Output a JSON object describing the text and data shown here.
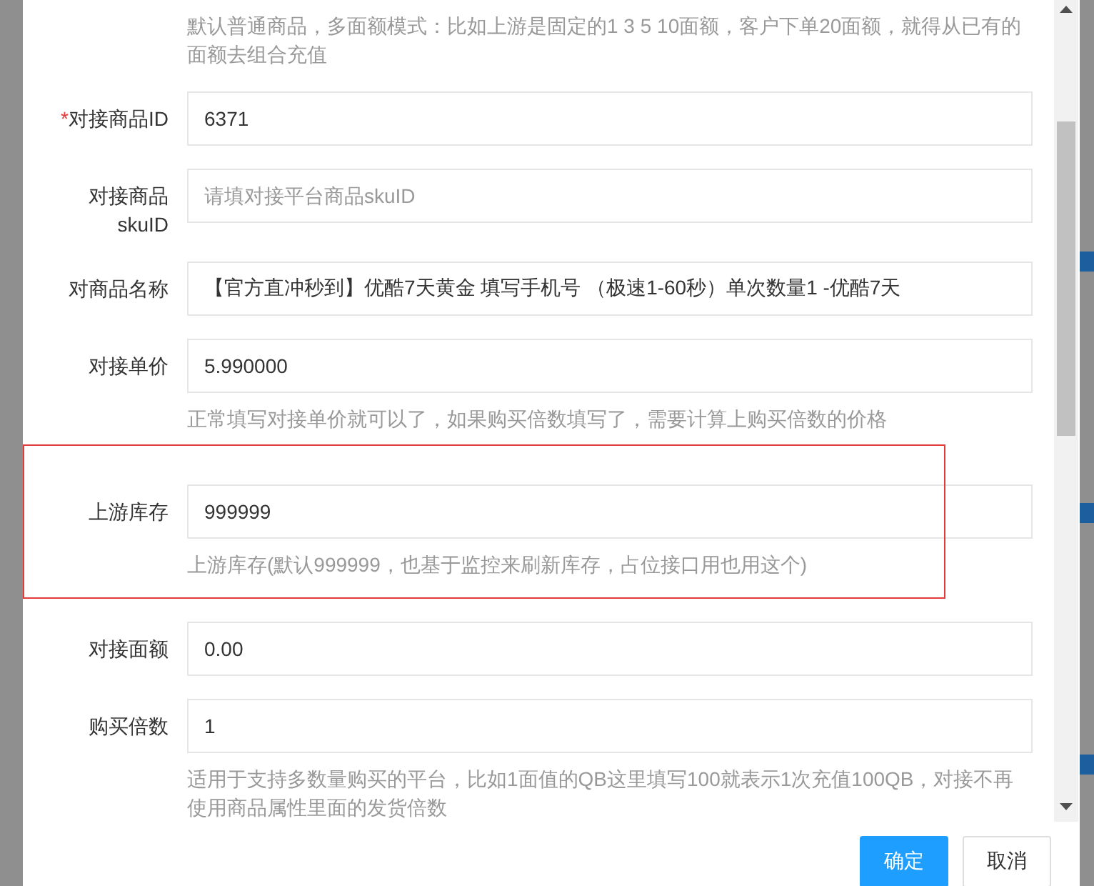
{
  "top_help": "默认普通商品，多面额模式：比如上游是固定的1 3 5 10面额，客户下单20面额，就得从已有的面额去组合充值",
  "fields": [
    {
      "label": "对接商品ID",
      "required_mark": "*",
      "value": "6371",
      "highlighted": false
    },
    {
      "label": "对接商品skuID",
      "placeholder": "请填对接平台商品skuID",
      "highlighted": false
    },
    {
      "label": "对商品名称",
      "value": "【官方直冲秒到】优酷7天黄金 填写手机号 （极速1-60秒）单次数量1 -优酷7天",
      "highlighted": false
    },
    {
      "label": "对接单价",
      "value": "5.990000",
      "help": "正常填写对接单价就可以了，如果购买倍数填写了，需要计算上购买倍数的价格",
      "highlighted": false
    },
    {
      "label": "上游库存",
      "value": "999999",
      "help": "上游库存(默认999999，也基于监控来刷新库存，占位接口用也用这个)",
      "highlighted": true
    },
    {
      "label": "对接面额",
      "value": "0.00",
      "highlighted": false
    },
    {
      "label": "购买倍数",
      "value": "1",
      "help": "适用于支持多数量购买的平台，比如1面值的QB这里填写100就表示1次充值100QB，对接不再使用商品属性里面的发货倍数",
      "highlighted": false
    }
  ],
  "buttons": [
    {
      "label": "确定",
      "kind": "primary"
    },
    {
      "label": "取消",
      "kind": "default"
    }
  ]
}
